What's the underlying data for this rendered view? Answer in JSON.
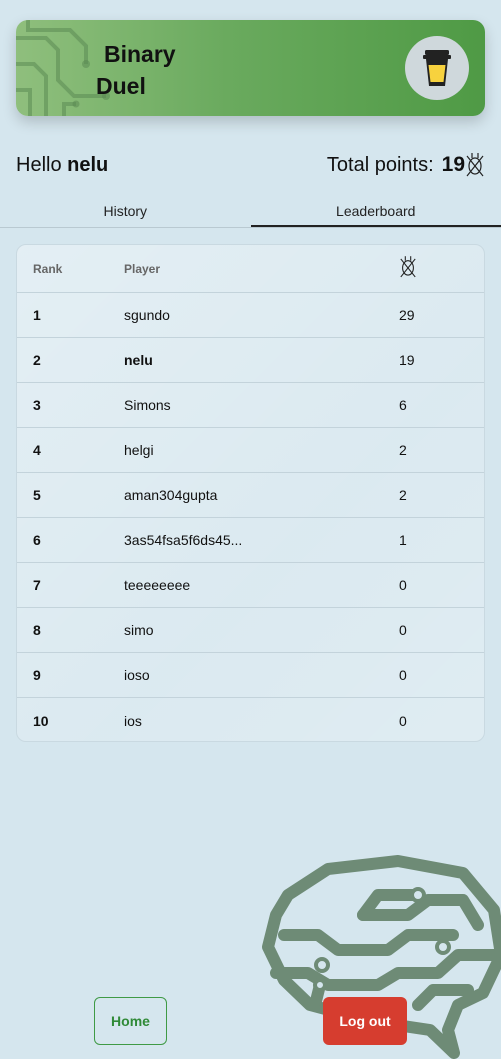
{
  "app": {
    "title_line1": "Binary",
    "title_line2": "Duel"
  },
  "greeting": {
    "prefix": "Hello",
    "username": "nelu"
  },
  "points": {
    "label": "Total points:",
    "value": "19"
  },
  "tabs": [
    {
      "label": "History",
      "active": false
    },
    {
      "label": "Leaderboard",
      "active": true
    }
  ],
  "leaderboard": {
    "headers": {
      "rank": "Rank",
      "player": "Player"
    },
    "rows": [
      {
        "rank": "1",
        "player": "sgundo",
        "points": "29"
      },
      {
        "rank": "2",
        "player": "nelu",
        "points": "19"
      },
      {
        "rank": "3",
        "player": "Simons",
        "points": "6"
      },
      {
        "rank": "4",
        "player": "helgi",
        "points": "2"
      },
      {
        "rank": "5",
        "player": "aman304gupta",
        "points": "2"
      },
      {
        "rank": "6",
        "player": "3as54fsa5f6ds45...",
        "points": "1"
      },
      {
        "rank": "7",
        "player": "teeeeeeee",
        "points": "0"
      },
      {
        "rank": "8",
        "player": "simo",
        "points": "0"
      },
      {
        "rank": "9",
        "player": "ioso",
        "points": "0"
      },
      {
        "rank": "10",
        "player": "ios",
        "points": "0"
      }
    ]
  },
  "buttons": {
    "home": "Home",
    "logout": "Log out"
  },
  "icons": {
    "cup": "coffee-cup-icon",
    "points": "bit-coin-icon",
    "brain": "circuit-brain-icon"
  },
  "colors": {
    "banner_start": "#8fbf7d",
    "banner_end": "#4f9a45",
    "home_green": "#2f8a37",
    "logout_red": "#d63d2f",
    "brain": "#6e8b76"
  }
}
